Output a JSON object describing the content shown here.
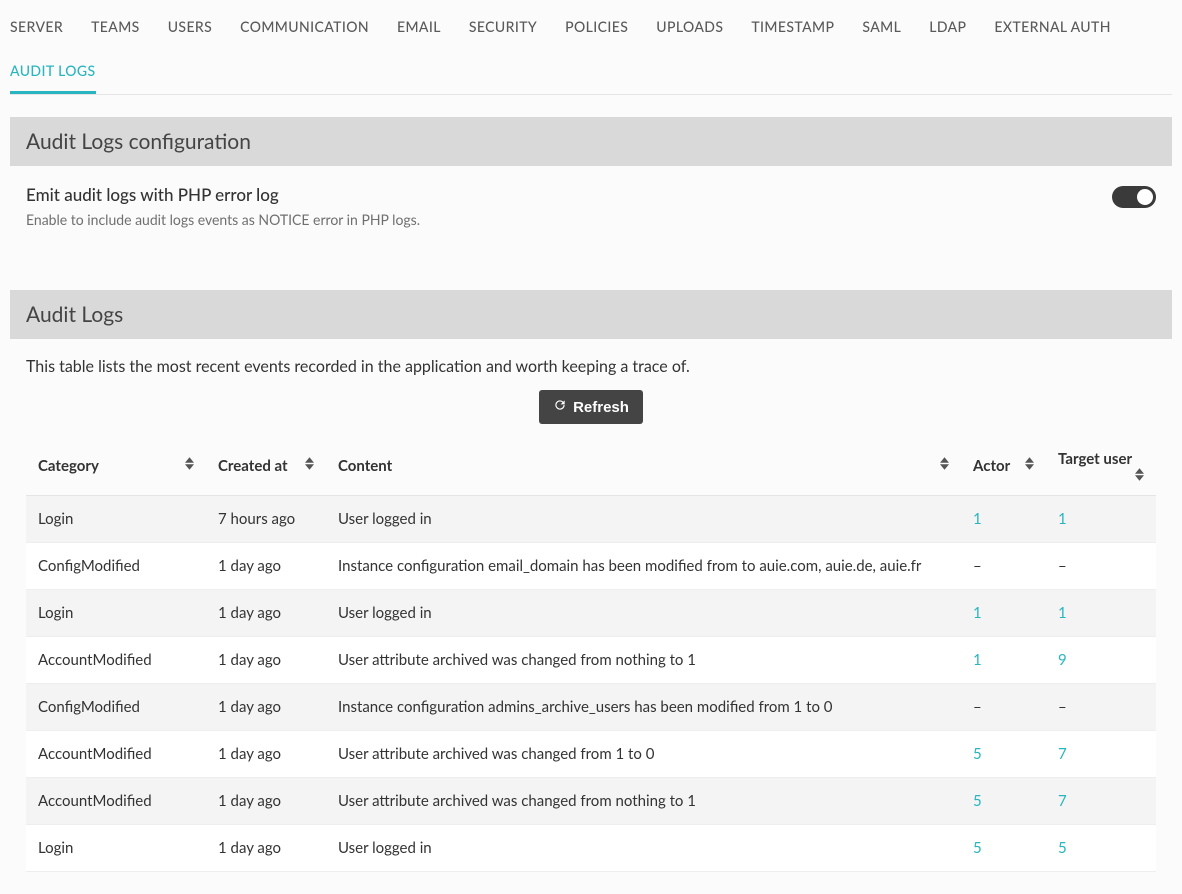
{
  "tabs": [
    {
      "label": "SERVER",
      "active": false
    },
    {
      "label": "TEAMS",
      "active": false
    },
    {
      "label": "USERS",
      "active": false
    },
    {
      "label": "COMMUNICATION",
      "active": false
    },
    {
      "label": "EMAIL",
      "active": false
    },
    {
      "label": "SECURITY",
      "active": false
    },
    {
      "label": "POLICIES",
      "active": false
    },
    {
      "label": "UPLOADS",
      "active": false
    },
    {
      "label": "TIMESTAMP",
      "active": false
    },
    {
      "label": "SAML",
      "active": false
    },
    {
      "label": "LDAP",
      "active": false
    },
    {
      "label": "EXTERNAL AUTH",
      "active": false
    },
    {
      "label": "AUDIT LOGS",
      "active": true
    }
  ],
  "config_section": {
    "title": "Audit Logs configuration",
    "option_title": "Emit audit logs with PHP error log",
    "option_desc": "Enable to include audit logs events as NOTICE error in PHP logs.",
    "toggle_on": false
  },
  "logs_section": {
    "title": "Audit Logs",
    "intro": "This table lists the most recent events recorded in the application and worth keeping a trace of.",
    "refresh_label": "Refresh",
    "columns": {
      "category": "Category",
      "created_at": "Created at",
      "content": "Content",
      "actor": "Actor",
      "target_user": "Target user"
    },
    "rows": [
      {
        "category": "Login",
        "created_at": "7 hours ago",
        "content": "User logged in",
        "actor": "1",
        "target": "1"
      },
      {
        "category": "ConfigModified",
        "created_at": "1 day ago",
        "content": "Instance configuration email_domain has been modified from to auie.com, auie.de, auie.fr",
        "actor": "–",
        "target": "–"
      },
      {
        "category": "Login",
        "created_at": "1 day ago",
        "content": "User logged in",
        "actor": "1",
        "target": "1"
      },
      {
        "category": "AccountModified",
        "created_at": "1 day ago",
        "content": "User attribute archived was changed from nothing to 1",
        "actor": "1",
        "target": "9"
      },
      {
        "category": "ConfigModified",
        "created_at": "1 day ago",
        "content": "Instance configuration admins_archive_users has been modified from 1 to 0",
        "actor": "–",
        "target": "–"
      },
      {
        "category": "AccountModified",
        "created_at": "1 day ago",
        "content": "User attribute archived was changed from 1 to 0",
        "actor": "5",
        "target": "7"
      },
      {
        "category": "AccountModified",
        "created_at": "1 day ago",
        "content": "User attribute archived was changed from nothing to 1",
        "actor": "5",
        "target": "7"
      },
      {
        "category": "Login",
        "created_at": "1 day ago",
        "content": "User logged in",
        "actor": "5",
        "target": "5"
      }
    ]
  }
}
